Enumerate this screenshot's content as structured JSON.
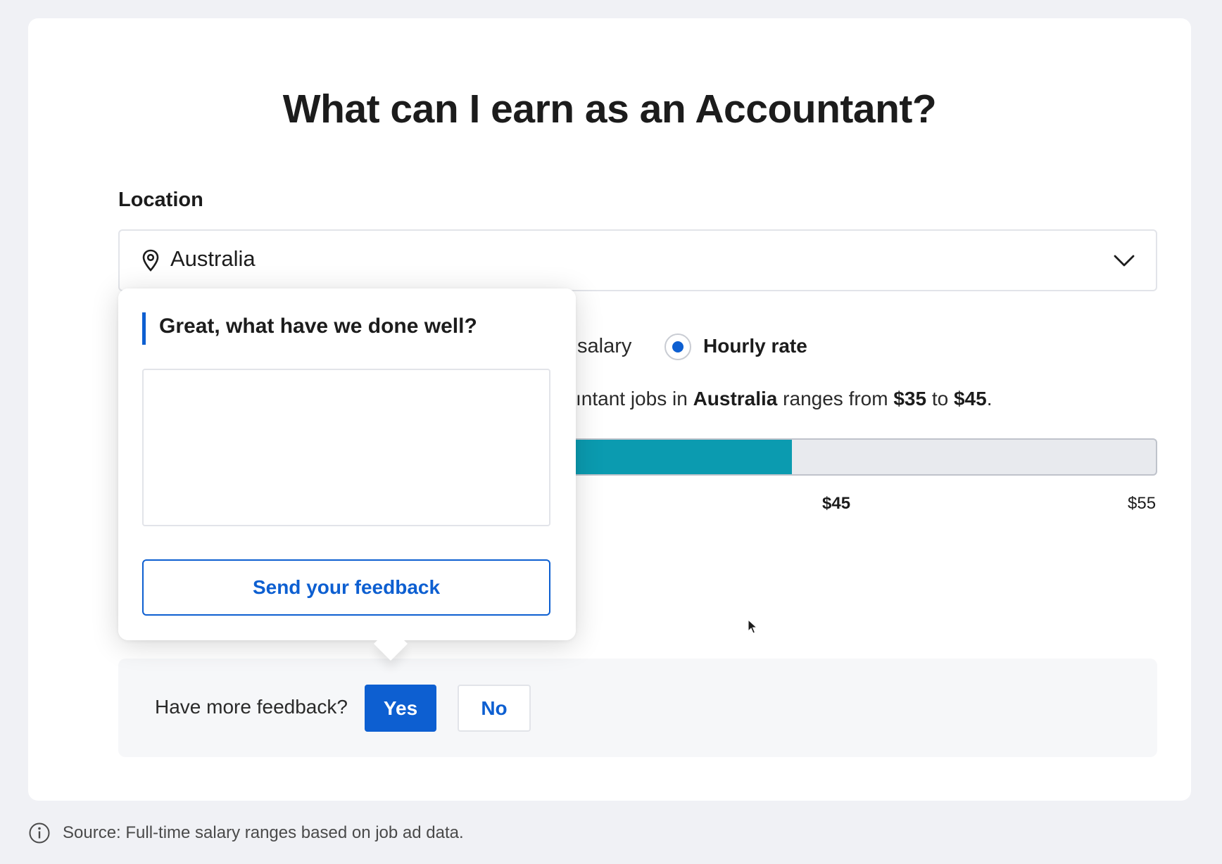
{
  "page_title": "What can I earn as an Accountant?",
  "location": {
    "label": "Location",
    "value": "Australia",
    "icon": "location-pin-icon",
    "dropdown_icon": "chevron-down-icon"
  },
  "pay_type": {
    "partial_option_label": "salary",
    "selected_option_label": "Hourly rate"
  },
  "range_sentence": {
    "prefix": "ıntant jobs in ",
    "location": "Australia",
    "middle": " ranges from ",
    "low": "$35",
    "connector": " to ",
    "high": "$45",
    "suffix": "."
  },
  "range_bar": {
    "fill_fraction": 0.425,
    "fill_color": "#0b9bb0",
    "ticks": [
      "$45",
      "$55"
    ]
  },
  "feedback_popover": {
    "title": "Great, what have we done well?",
    "textarea_value": "",
    "send_button_label": "Send your feedback"
  },
  "feedback_bar": {
    "question": "Have more feedback?",
    "yes_label": "Yes",
    "no_label": "No"
  },
  "footer": {
    "icon": "info-icon",
    "source_text": "Source: Full-time salary ranges based on job ad data."
  },
  "colors": {
    "primary": "#0d5fd1",
    "bar_fill": "#0b9bb0",
    "page_bg": "#f0f1f5"
  }
}
